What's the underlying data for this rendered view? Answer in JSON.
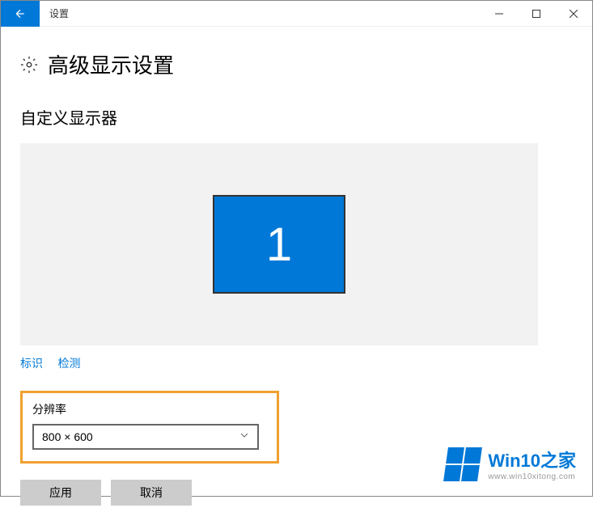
{
  "titlebar": {
    "app_title": "设置"
  },
  "header": {
    "page_title": "高级显示设置"
  },
  "section": {
    "custom_display_title": "自定义显示器",
    "display_number": "1"
  },
  "links": {
    "identify": "标识",
    "detect": "检测"
  },
  "resolution": {
    "label": "分辨率",
    "selected": "800 × 600"
  },
  "buttons": {
    "apply": "应用",
    "cancel": "取消"
  },
  "watermark": {
    "brand_prefix": "Win10",
    "brand_suffix": "之家",
    "url": "www.win10xitong.com"
  }
}
